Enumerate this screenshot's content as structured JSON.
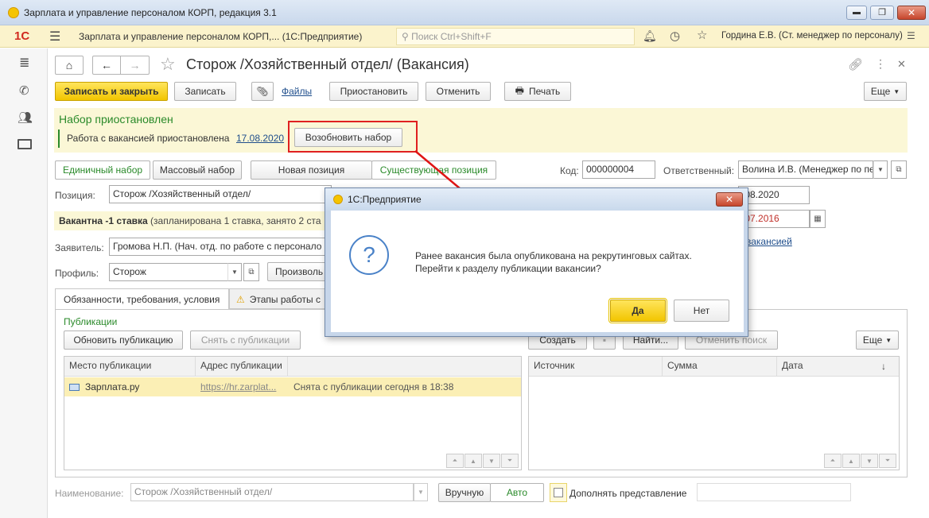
{
  "window": {
    "title": "Зарплата и управление персоналом КОРП, редакция 3.1",
    "controls": [
      "‒",
      "❐",
      "✕"
    ]
  },
  "appbar": {
    "logo": "1С",
    "title": "Зарплата и управление персоналом КОРП,... (1С:Предприятие)",
    "search_placeholder": "Поиск Ctrl+Shift+F",
    "user": "Гордина Е.В. (Ст. менеджер по персоналу)"
  },
  "form": {
    "title": "Сторож /Хозяйственный отдел/ (Вакансия)",
    "toolbar": {
      "save_close": "Записать и закрыть",
      "save": "Записать",
      "files": "Файлы",
      "pause": "Приостановить",
      "cancel": "Отменить",
      "print": "Печать",
      "more": "Еще"
    },
    "banner": {
      "heading": "Набор приостановлен",
      "text": "Работа с вакансией приостановлена",
      "date": "17.08.2020",
      "resume": "Возобновить набор"
    },
    "mode": {
      "single": "Единичный набор",
      "mass": "Массовый набор",
      "new_pos": "Новая позиция",
      "existing_pos": "Существующая позиция"
    },
    "code_label": "Код:",
    "code": "000000004",
    "resp_label": "Ответственный:",
    "resp": "Волина И.В. (Менеджер по пе",
    "date1": ".08.2020",
    "date2": ".07.2016",
    "link_vac": "вакансией",
    "position_label": "Позиция:",
    "position": "Сторож /Хозяйственный отдел/",
    "vacancy_bold": "Вакантна -1 ставка",
    "vacancy_rest": " (запланирована 1 ставка, занято 2 ста",
    "applicant_label": "Заявитель:",
    "applicant": "Громова Н.П. (Нач. отд. по работе с персонало",
    "profile_label": "Профиль:",
    "profile": "Сторож",
    "arbitrary": "Произволь",
    "tabs": {
      "t1": "Обязанности, требования, условия",
      "t2": "Этапы работы с"
    },
    "pub": {
      "heading": "Публикации",
      "refresh": "Обновить публикацию",
      "remove": "Снять с публикации",
      "cols": [
        "Место публикации",
        "Адрес публикации"
      ],
      "row": {
        "place": "Зарплата.ру",
        "url": "https://hr.zarplat...",
        "status": "Снята с публикации сегодня в 18:38"
      }
    },
    "right": {
      "create": "Создать",
      "find": "Найти...",
      "cancel_find": "Отменить поиск",
      "more": "Еще",
      "cols": [
        "Источник",
        "Сумма",
        "Дата"
      ],
      "sort": "↓"
    },
    "bottom": {
      "name_label": "Наименование:",
      "name": "Сторож /Хозяйственный отдел/",
      "manual": "Вручную",
      "auto": "Авто",
      "supplement": "Дополнять представление"
    }
  },
  "dialog": {
    "title": "1С:Предприятие",
    "message": "Ранее вакансия была опубликована на рекрутинговых сайтах. Перейти к разделу публикации вакансии?",
    "yes": "Да",
    "no": "Нет"
  }
}
